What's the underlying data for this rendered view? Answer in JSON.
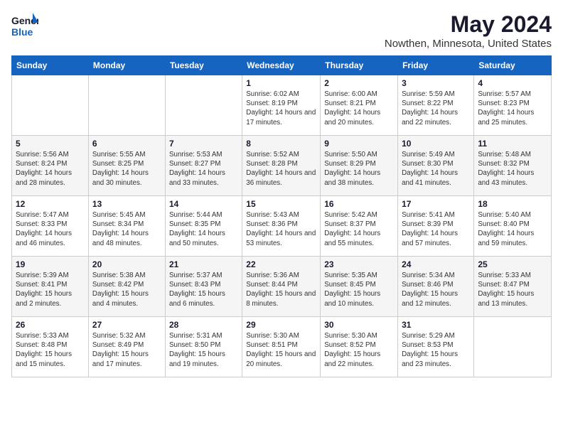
{
  "header": {
    "logo_general": "General",
    "logo_blue": "Blue",
    "title": "May 2024",
    "location": "Nowthen, Minnesota, United States"
  },
  "days_of_week": [
    "Sunday",
    "Monday",
    "Tuesday",
    "Wednesday",
    "Thursday",
    "Friday",
    "Saturday"
  ],
  "weeks": [
    {
      "days": [
        {
          "num": "",
          "detail": ""
        },
        {
          "num": "",
          "detail": ""
        },
        {
          "num": "",
          "detail": ""
        },
        {
          "num": "1",
          "detail": "Sunrise: 6:02 AM\nSunset: 8:19 PM\nDaylight: 14 hours\nand 17 minutes."
        },
        {
          "num": "2",
          "detail": "Sunrise: 6:00 AM\nSunset: 8:21 PM\nDaylight: 14 hours\nand 20 minutes."
        },
        {
          "num": "3",
          "detail": "Sunrise: 5:59 AM\nSunset: 8:22 PM\nDaylight: 14 hours\nand 22 minutes."
        },
        {
          "num": "4",
          "detail": "Sunrise: 5:57 AM\nSunset: 8:23 PM\nDaylight: 14 hours\nand 25 minutes."
        }
      ]
    },
    {
      "days": [
        {
          "num": "5",
          "detail": "Sunrise: 5:56 AM\nSunset: 8:24 PM\nDaylight: 14 hours\nand 28 minutes."
        },
        {
          "num": "6",
          "detail": "Sunrise: 5:55 AM\nSunset: 8:25 PM\nDaylight: 14 hours\nand 30 minutes."
        },
        {
          "num": "7",
          "detail": "Sunrise: 5:53 AM\nSunset: 8:27 PM\nDaylight: 14 hours\nand 33 minutes."
        },
        {
          "num": "8",
          "detail": "Sunrise: 5:52 AM\nSunset: 8:28 PM\nDaylight: 14 hours\nand 36 minutes."
        },
        {
          "num": "9",
          "detail": "Sunrise: 5:50 AM\nSunset: 8:29 PM\nDaylight: 14 hours\nand 38 minutes."
        },
        {
          "num": "10",
          "detail": "Sunrise: 5:49 AM\nSunset: 8:30 PM\nDaylight: 14 hours\nand 41 minutes."
        },
        {
          "num": "11",
          "detail": "Sunrise: 5:48 AM\nSunset: 8:32 PM\nDaylight: 14 hours\nand 43 minutes."
        }
      ]
    },
    {
      "days": [
        {
          "num": "12",
          "detail": "Sunrise: 5:47 AM\nSunset: 8:33 PM\nDaylight: 14 hours\nand 46 minutes."
        },
        {
          "num": "13",
          "detail": "Sunrise: 5:45 AM\nSunset: 8:34 PM\nDaylight: 14 hours\nand 48 minutes."
        },
        {
          "num": "14",
          "detail": "Sunrise: 5:44 AM\nSunset: 8:35 PM\nDaylight: 14 hours\nand 50 minutes."
        },
        {
          "num": "15",
          "detail": "Sunrise: 5:43 AM\nSunset: 8:36 PM\nDaylight: 14 hours\nand 53 minutes."
        },
        {
          "num": "16",
          "detail": "Sunrise: 5:42 AM\nSunset: 8:37 PM\nDaylight: 14 hours\nand 55 minutes."
        },
        {
          "num": "17",
          "detail": "Sunrise: 5:41 AM\nSunset: 8:39 PM\nDaylight: 14 hours\nand 57 minutes."
        },
        {
          "num": "18",
          "detail": "Sunrise: 5:40 AM\nSunset: 8:40 PM\nDaylight: 14 hours\nand 59 minutes."
        }
      ]
    },
    {
      "days": [
        {
          "num": "19",
          "detail": "Sunrise: 5:39 AM\nSunset: 8:41 PM\nDaylight: 15 hours\nand 2 minutes."
        },
        {
          "num": "20",
          "detail": "Sunrise: 5:38 AM\nSunset: 8:42 PM\nDaylight: 15 hours\nand 4 minutes."
        },
        {
          "num": "21",
          "detail": "Sunrise: 5:37 AM\nSunset: 8:43 PM\nDaylight: 15 hours\nand 6 minutes."
        },
        {
          "num": "22",
          "detail": "Sunrise: 5:36 AM\nSunset: 8:44 PM\nDaylight: 15 hours\nand 8 minutes."
        },
        {
          "num": "23",
          "detail": "Sunrise: 5:35 AM\nSunset: 8:45 PM\nDaylight: 15 hours\nand 10 minutes."
        },
        {
          "num": "24",
          "detail": "Sunrise: 5:34 AM\nSunset: 8:46 PM\nDaylight: 15 hours\nand 12 minutes."
        },
        {
          "num": "25",
          "detail": "Sunrise: 5:33 AM\nSunset: 8:47 PM\nDaylight: 15 hours\nand 13 minutes."
        }
      ]
    },
    {
      "days": [
        {
          "num": "26",
          "detail": "Sunrise: 5:33 AM\nSunset: 8:48 PM\nDaylight: 15 hours\nand 15 minutes."
        },
        {
          "num": "27",
          "detail": "Sunrise: 5:32 AM\nSunset: 8:49 PM\nDaylight: 15 hours\nand 17 minutes."
        },
        {
          "num": "28",
          "detail": "Sunrise: 5:31 AM\nSunset: 8:50 PM\nDaylight: 15 hours\nand 19 minutes."
        },
        {
          "num": "29",
          "detail": "Sunrise: 5:30 AM\nSunset: 8:51 PM\nDaylight: 15 hours\nand 20 minutes."
        },
        {
          "num": "30",
          "detail": "Sunrise: 5:30 AM\nSunset: 8:52 PM\nDaylight: 15 hours\nand 22 minutes."
        },
        {
          "num": "31",
          "detail": "Sunrise: 5:29 AM\nSunset: 8:53 PM\nDaylight: 15 hours\nand 23 minutes."
        },
        {
          "num": "",
          "detail": ""
        }
      ]
    }
  ]
}
